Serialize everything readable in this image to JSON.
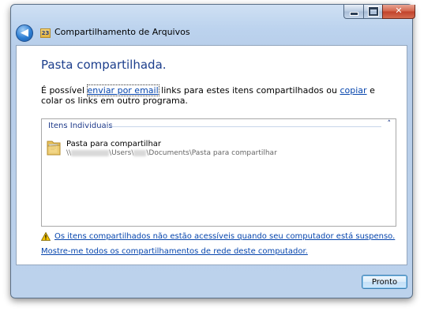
{
  "window": {
    "title": "Compartilhamento de Arquivos",
    "app_icon_text": "23",
    "controls": {
      "minimize_icon": "minimize-icon",
      "maximize_icon": "maximize-icon",
      "close_glyph": "✕"
    },
    "back_glyph": "◀"
  },
  "main": {
    "heading": "Pasta compartilhada.",
    "description": {
      "part1": "É possível ",
      "email_link": "enviar por email",
      "part2": " links para estes itens compartilhados ou ",
      "copy_link": "copiar",
      "part3": " e colar os links em outro programa."
    },
    "items_panel": {
      "header": "Itens Individuais",
      "chevron": "˄",
      "items": [
        {
          "name": "Pasta para compartilhar",
          "path_prefix": "\\\\",
          "path_middle": "\\Users\\",
          "path_suffix": "\\Documents\\Pasta para compartilhar"
        }
      ]
    },
    "warning_link": "Os itens compartilhados não estão acessíveis quando seu computador está suspenso.",
    "shares_link": "Mostre-me todos os compartilhamentos de rede deste computador."
  },
  "footer": {
    "ok_button": "Pronto"
  },
  "colors": {
    "heading": "#1c3e8c",
    "link": "#0645ad",
    "warning": "#f5c400"
  }
}
